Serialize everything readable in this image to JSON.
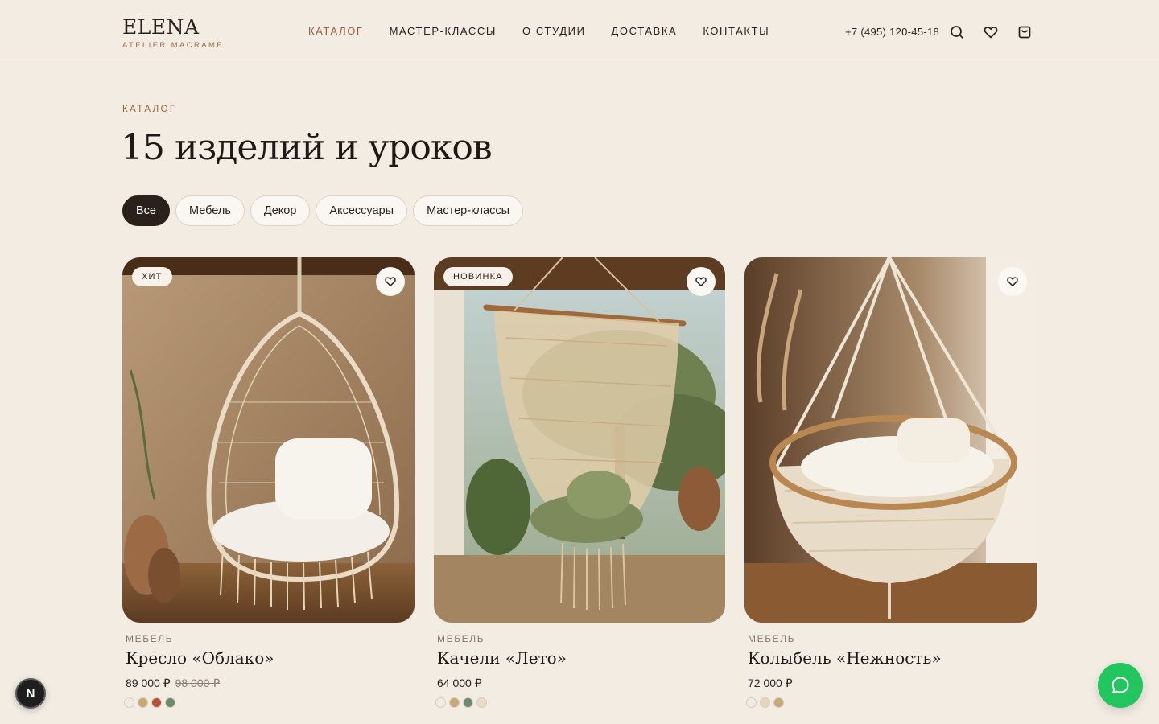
{
  "brand": {
    "name": "ELENA",
    "subtitle": "ATELIER MACRAME"
  },
  "nav": [
    {
      "label": "КАТАЛОГ",
      "active": true
    },
    {
      "label": "МАСТЕР-КЛАССЫ",
      "active": false
    },
    {
      "label": "О СТУДИИ",
      "active": false
    },
    {
      "label": "ДОСТАВКА",
      "active": false
    },
    {
      "label": "КОНТАКТЫ",
      "active": false
    }
  ],
  "header": {
    "phone": "+7 (495) 120-45-18",
    "icons": [
      "search-icon",
      "heart-icon",
      "shopping-bag-icon"
    ]
  },
  "catalog": {
    "eyebrow": "КАТАЛОГ",
    "title": "15 изделий и уроков",
    "filters": [
      {
        "label": "Все",
        "active": true
      },
      {
        "label": "Мебель",
        "active": false
      },
      {
        "label": "Декор",
        "active": false
      },
      {
        "label": "Аксессуары",
        "active": false
      },
      {
        "label": "Мастер-классы",
        "active": false
      }
    ]
  },
  "products": [
    {
      "badge": "ХИТ",
      "category": "МЕБЕЛЬ",
      "title": "Кресло «Облако»",
      "price": "89 000 ₽",
      "old_price": "98 000 ₽",
      "swatches": [
        "#f1ebe2",
        "#c7a877",
        "#b4533b",
        "#6d8a6c"
      ]
    },
    {
      "badge": "НОВИНКА",
      "category": "МЕБЕЛЬ",
      "title": "Качели «Лето»",
      "price": "64 000 ₽",
      "old_price": "",
      "swatches": [
        "#f1ebe2",
        "#c7a877",
        "#6d8a6c",
        "#e8dcc6"
      ]
    },
    {
      "badge": "",
      "category": "МЕБЕЛЬ",
      "title": "Колыбель «Нежность»",
      "price": "72 000 ₽",
      "old_price": "",
      "swatches": [
        "#f1ebe2",
        "#e4d6bf",
        "#c7a877"
      ]
    }
  ],
  "floating": {
    "n_badge": "N",
    "chat_icon": "chat-bubble-icon"
  },
  "colors": {
    "accent": "#9b5e3c",
    "background": "#f3ece3",
    "dark": "#2a211c",
    "chat": "#22c55e"
  }
}
